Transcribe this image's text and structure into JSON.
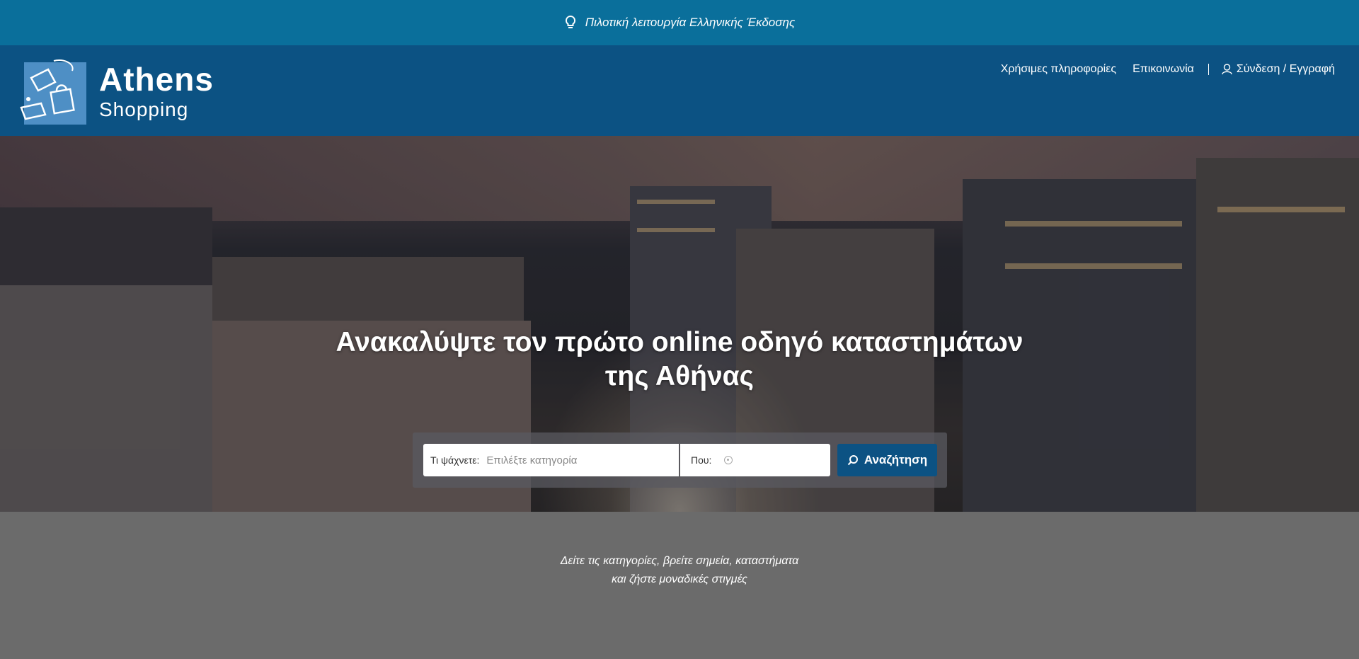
{
  "announcement": {
    "text": "Πιλοτική λειτουργία Ελληνικής Έκδοσης",
    "icon": "lightbulb-icon"
  },
  "brand": {
    "name_line1": "Athens",
    "name_line2": "Shopping",
    "colors": {
      "topbar": "#0a6f9b",
      "header": "#0c5283",
      "button": "#0c5283"
    }
  },
  "nav": {
    "items": [
      {
        "label": "Χρήσιμες πληροφορίες"
      },
      {
        "label": "Επικοινωνία"
      }
    ],
    "login_label": "Σύνδεση / Εγγραφή"
  },
  "hero": {
    "headline_line1": "Ανακαλύψτε τον πρώτο online οδηγό καταστημάτων",
    "headline_line2": "της Αθήνας"
  },
  "search": {
    "what_label": "Τι ψάχνετε:",
    "what_placeholder": "Επιλέξτε κατηγορία",
    "where_label": "Που:",
    "button_label": "Αναζήτηση"
  },
  "tagline": {
    "line1": "Δείτε τις κατηγορίες, βρείτε σημεία, καταστήματα",
    "line2": "και ζήστε μοναδικές στιγμές"
  }
}
